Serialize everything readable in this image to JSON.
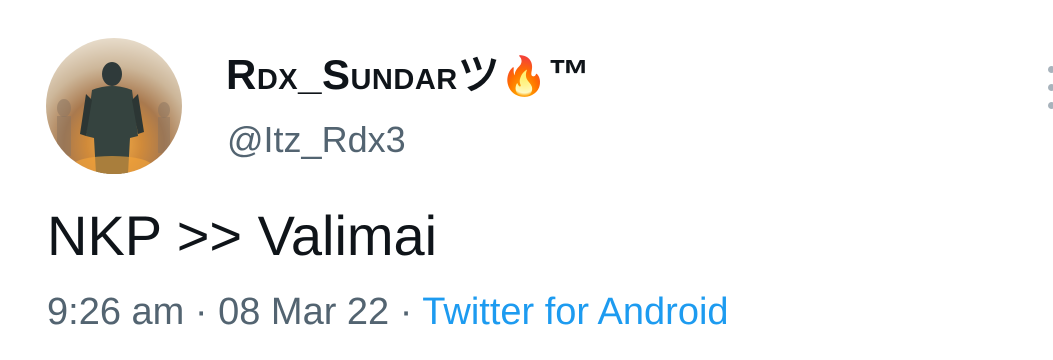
{
  "tweet": {
    "author": {
      "display_name": "Rdx_Sundar",
      "name_suffix": "ツ",
      "name_emoji": "🔥",
      "name_trademark": "™",
      "handle": "@Itz_Rdx3"
    },
    "text": "NKP >> Valimai",
    "time": "9:26 am",
    "separator": "·",
    "date": "08 Mar 22",
    "source": "Twitter for Android"
  },
  "icons": {
    "more": "more-options-icon",
    "avatar": "profile-avatar"
  },
  "colors": {
    "text_primary": "#0f1419",
    "text_secondary": "#536471",
    "link": "#1d9bf0"
  }
}
